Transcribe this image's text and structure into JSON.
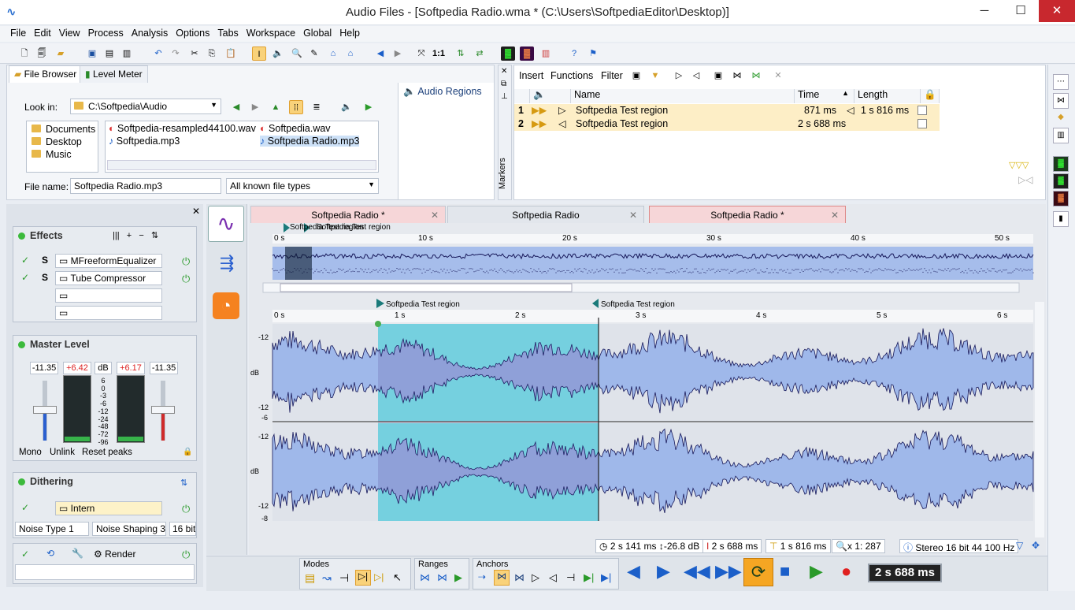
{
  "title": "Audio Files - [Softpedia Radio.wma * (C:\\Users\\SoftpediaEditor\\Desktop)]",
  "menu": [
    "File",
    "Edit",
    "View",
    "Process",
    "Analysis",
    "Options",
    "Tabs",
    "Workspace",
    "Global",
    "Help"
  ],
  "toolbar": {
    "one_to_one": "1:1"
  },
  "file_browser": {
    "tabs": [
      "File Browser",
      "Level Meter"
    ],
    "look_in_label": "Look in:",
    "look_in_value": "C:\\Softpedia\\Audio",
    "folders": [
      "Documents",
      "Desktop",
      "Music"
    ],
    "files": [
      "Softpedia-resampled44100.wav",
      "Softpedia.wav",
      "Softpedia.mp3",
      "Softpedia Radio.mp3"
    ],
    "file_name_label": "File name:",
    "file_name_value": "Softpedia Radio.mp3",
    "file_type": "All known file types"
  },
  "audio_regions": {
    "title": "Audio Regions"
  },
  "markers": {
    "label": "Markers"
  },
  "regions_table": {
    "toolbar": [
      "Insert",
      "Functions",
      "Filter"
    ],
    "headers": {
      "name": "Name",
      "time": "Time",
      "length": "Length"
    },
    "rows": [
      {
        "index": "1",
        "name": "Softpedia Test region",
        "time": "871 ms",
        "length": "1 s 816 ms"
      },
      {
        "index": "2",
        "name": "Softpedia Test region",
        "time": "2 s 688 ms",
        "length": ""
      }
    ]
  },
  "effects": {
    "title": "Effects",
    "plugins": [
      "MFreeformEqualizer",
      "Tube Compressor",
      "",
      ""
    ]
  },
  "master_level": {
    "title": "Master Level",
    "values": [
      "-11.35",
      "+6.42",
      "dB",
      "+6.17",
      "-11.35"
    ],
    "scale": [
      "6",
      "0",
      "-3",
      "-6",
      "-12",
      "-24",
      "-48",
      "-72",
      "-96"
    ],
    "buttons": [
      "Mono",
      "Unlink",
      "Reset peaks"
    ]
  },
  "dithering": {
    "title": "Dithering",
    "plugin": "Intern",
    "noise_type": "Noise Type 1",
    "noise_shaping": "Noise Shaping 3",
    "bits": "16 bit"
  },
  "render": {
    "label": "Render"
  },
  "wave_tabs": [
    "Softpedia Radio *",
    "Softpedia Radio",
    "Softpedia Radio *"
  ],
  "overview_ruler": [
    "0 s",
    "10 s",
    "20 s",
    "30 s",
    "40 s",
    "50 s"
  ],
  "overview_markers": [
    "Softpedia Test region",
    "Softpedia Test region"
  ],
  "main_ruler": [
    "0 s",
    "1 s",
    "2 s",
    "3 s",
    "4 s",
    "5 s",
    "6 s"
  ],
  "main_markers": [
    "Softpedia Test region",
    "Softpedia Test region"
  ],
  "db_labels": {
    "top": [
      "-12",
      "dB",
      "-12",
      "-6"
    ],
    "bottom": [
      "-12",
      "dB",
      "-12",
      "-8"
    ]
  },
  "status": {
    "cursor": "2 s 141 ms",
    "level": "-26.8 dB",
    "position": "2 s 688 ms",
    "selection": "1 s 816 ms",
    "zoom": "x 1: 287",
    "format": "Stereo 16 bit 44 100 Hz"
  },
  "transport": {
    "groups": [
      "Modes",
      "Ranges",
      "Anchors"
    ],
    "time": "2 s 688 ms"
  },
  "colors": {
    "selection": "#7ff2f2",
    "wave": "#9fb8ea",
    "wave_line": "#17185a",
    "accent": "#f5a623",
    "record": "#e02020"
  }
}
